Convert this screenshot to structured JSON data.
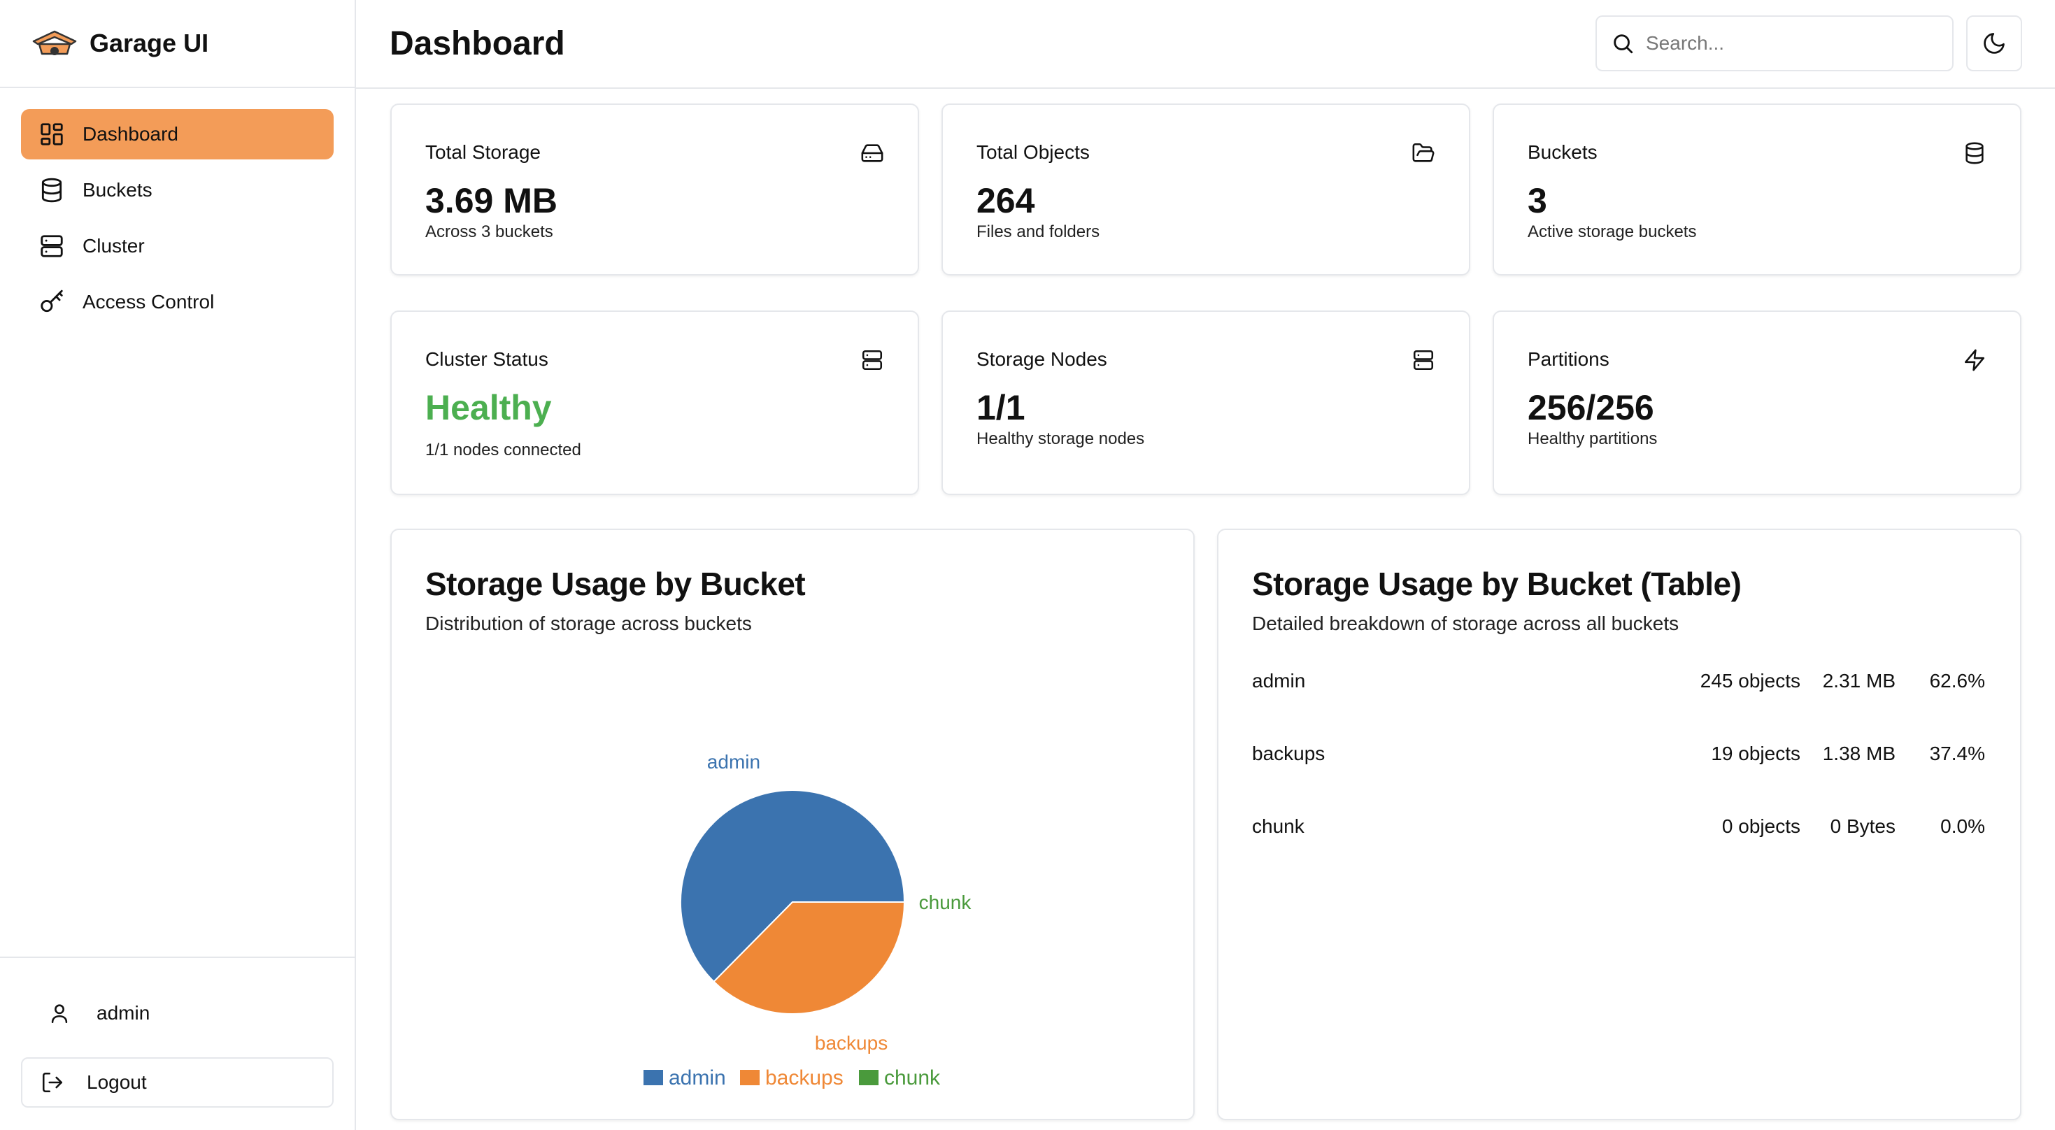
{
  "app": {
    "title": "Garage UI"
  },
  "sidebar": {
    "items": [
      {
        "label": "Dashboard",
        "active": true,
        "icon": "layout-dashboard-icon"
      },
      {
        "label": "Buckets",
        "active": false,
        "icon": "database-icon"
      },
      {
        "label": "Cluster",
        "active": false,
        "icon": "server-icon"
      },
      {
        "label": "Access Control",
        "active": false,
        "icon": "key-icon"
      }
    ],
    "user": "admin",
    "logout_label": "Logout"
  },
  "header": {
    "title": "Dashboard",
    "search_placeholder": "Search..."
  },
  "stats": [
    {
      "title": "Total Storage",
      "value": "3.69 MB",
      "sub": "Across 3 buckets",
      "icon": "hard-drive-icon"
    },
    {
      "title": "Total Objects",
      "value": "264",
      "sub": "Files and folders",
      "icon": "folder-open-icon"
    },
    {
      "title": "Buckets",
      "value": "3",
      "sub": "Active storage buckets",
      "icon": "database-icon"
    },
    {
      "title": "Cluster Status",
      "value": "Healthy",
      "sub": "1/1 nodes connected",
      "icon": "server-icon"
    },
    {
      "title": "Storage Nodes",
      "value": "1/1",
      "sub": "Healthy storage nodes",
      "icon": "server-icon"
    },
    {
      "title": "Partitions",
      "value": "256/256",
      "sub": "Healthy partitions",
      "icon": "zap-icon"
    }
  ],
  "colors": {
    "accent": "#f39c58",
    "healthy": "#4caf50",
    "admin": "#3b73af",
    "backups": "#ef8836",
    "chunk": "#4a9a3c"
  },
  "chart_panel": {
    "title": "Storage Usage by Bucket",
    "subtitle": "Distribution of storage across buckets"
  },
  "chart_data": {
    "type": "pie",
    "categories": [
      "admin",
      "backups",
      "chunk"
    ],
    "values": [
      62.6,
      37.4,
      0.0
    ],
    "colors": [
      "#3b73af",
      "#ef8836",
      "#4a9a3c"
    ],
    "legend": "bottom"
  },
  "table_panel": {
    "title": "Storage Usage by Bucket (Table)",
    "subtitle": "Detailed breakdown of storage across all buckets",
    "rows": [
      {
        "name": "admin",
        "objects": "245 objects",
        "size": "2.31 MB",
        "pct": "62.6%"
      },
      {
        "name": "backups",
        "objects": "19 objects",
        "size": "1.38 MB",
        "pct": "37.4%"
      },
      {
        "name": "chunk",
        "objects": "0 objects",
        "size": "0 Bytes",
        "pct": "0.0%"
      }
    ]
  }
}
